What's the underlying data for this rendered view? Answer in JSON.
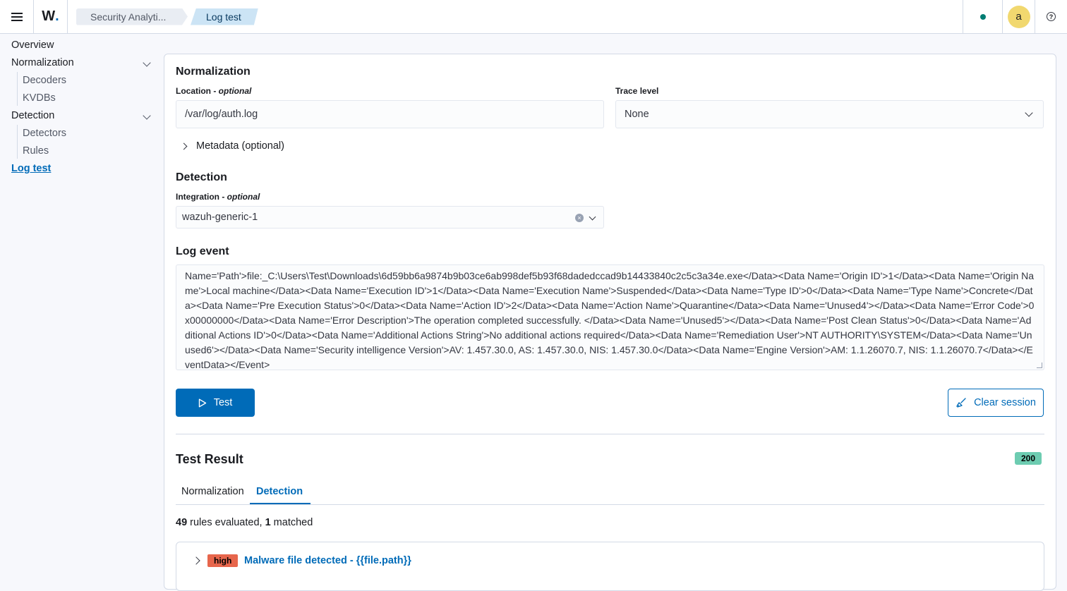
{
  "header": {
    "logo_letter": "W",
    "logo_dot": ".",
    "breadcrumbs": [
      "Security Analyti...",
      "Log test"
    ],
    "avatar_initial": "a",
    "help_glyph": "?"
  },
  "sidebar": {
    "items": [
      {
        "label": "Overview"
      },
      {
        "label": "Normalization"
      },
      {
        "label": "Decoders"
      },
      {
        "label": "KVDBs"
      },
      {
        "label": "Detection"
      },
      {
        "label": "Detectors"
      },
      {
        "label": "Rules"
      },
      {
        "label": "Log test"
      }
    ]
  },
  "normalization": {
    "title": "Normalization",
    "location_label": "Location",
    "location_optional": "optional",
    "location_value": "/var/log/auth.log",
    "trace_label": "Trace level",
    "trace_value": "None",
    "metadata_toggle": "Metadata (optional)"
  },
  "detection": {
    "title": "Detection",
    "integration_label": "Integration",
    "integration_optional": "optional",
    "integration_value": "wazuh-generic-1"
  },
  "log_event": {
    "title": "Log event",
    "text": "Name='Path'>file:_C:\\Users\\Test\\Downloads\\6d59bb6a9874b9b03ce6ab998def5b93f68dadedccad9b14433840c2c5c3a34e.exe</Data><Data Name='Origin ID'>1</Data><Data Name='Origin Name'>Local machine</Data><Data Name='Execution ID'>1</Data><Data Name='Execution Name'>Suspended</Data><Data Name='Type ID'>0</Data><Data Name='Type Name'>Concrete</Data><Data Name='Pre Execution Status'>0</Data><Data Name='Action ID'>2</Data><Data Name='Action Name'>Quarantine</Data><Data Name='Unused4'></Data><Data Name='Error Code'>0x00000000</Data><Data Name='Error Description'>The operation completed successfully. </Data><Data Name='Unused5'></Data><Data Name='Post Clean Status'>0</Data><Data Name='Additional Actions ID'>0</Data><Data Name='Additional Actions String'>No additional actions required</Data><Data Name='Remediation User'>NT AUTHORITY\\SYSTEM</Data><Data Name='Unused6'></Data><Data Name='Security intelligence Version'>AV: 1.457.30.0, AS: 1.457.30.0, NIS: 1.457.30.0</Data><Data Name='Engine Version'>AM: 1.1.26070.7, NIS: 1.1.26070.7</Data></EventData></Event>"
  },
  "actions": {
    "test_label": "Test",
    "clear_label": "Clear session"
  },
  "result": {
    "title": "Test Result",
    "status_code": "200",
    "tabs": [
      "Normalization",
      "Detection"
    ],
    "rules_evaluated": "49",
    "rules_evaluated_text": " rules evaluated, ",
    "matched": "1",
    "matched_text": " matched",
    "rule": {
      "severity": "high",
      "title": "Malware file detected - {{file.path}}"
    }
  },
  "colors": {
    "primary": "#006bb8",
    "success": "#6dccb1",
    "high_severity": "#e7664c",
    "status_dot": "#017d73",
    "avatar": "#f1d86f"
  }
}
